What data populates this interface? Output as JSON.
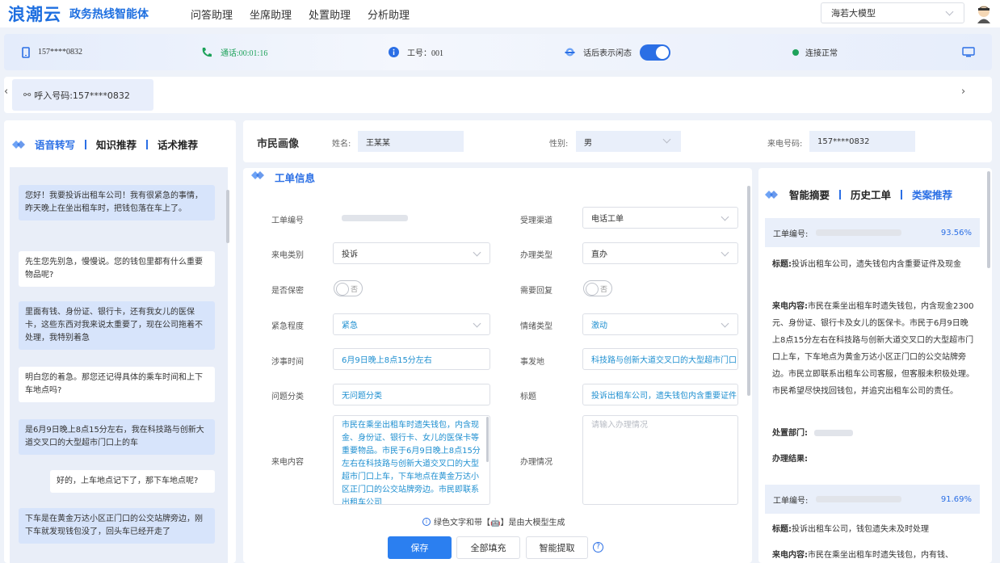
{
  "app": {
    "logo": "浪潮云",
    "subtitle": "政务热线智能体"
  },
  "nav": {
    "items": [
      "问答助理",
      "坐席助理",
      "处置助理",
      "分析助理"
    ]
  },
  "model_select": {
    "value": "海若大模型"
  },
  "status": {
    "phone": "157****0832",
    "call_time": "通话:00:01:16",
    "employee_id": "工号：001",
    "after_call_label": "话后表示闲态",
    "connection": "连接正常"
  },
  "callbar": {
    "caller_label": "呼入号码:157****0832"
  },
  "left_panel": {
    "tabs": [
      "语音转写",
      "知识推荐",
      "话术推荐"
    ],
    "messages": [
      {
        "role": "citizen",
        "text": "您好！我要投诉出租车公司！我有很紧急的事情，昨天晚上在坐出租车时，把钱包落在车上了。"
      },
      {
        "role": "agent",
        "text": "先生您先别急，慢慢说。您的钱包里都有什么重要物品呢?"
      },
      {
        "role": "citizen",
        "text": "里面有钱、身份证、银行卡，还有我女儿的医保卡，这些东西对我来说太重要了，现在公司拖着不处理，我特别着急"
      },
      {
        "role": "agent",
        "text": "明白您的着急。那您还记得具体的乘车时间和上下车地点吗?"
      },
      {
        "role": "citizen",
        "text": "是6月9日晚上8点15分左右，我在科技路与创新大道交叉口的大型超市门口上的车"
      },
      {
        "role": "agent",
        "text": "好的，上车地点记下了，那下车地点呢?"
      },
      {
        "role": "citizen",
        "text": "下车是在黄金万达小区正门口的公交站牌旁边，刚下车就发现钱包没了，回头车已经开走了"
      }
    ]
  },
  "profile": {
    "title": "市民画像",
    "name_label": "姓名:",
    "name_value": "王某某",
    "gender_label": "性别:",
    "gender_value": "男",
    "phone_label": "来电号码:",
    "phone_value": "157****0832"
  },
  "workorder": {
    "title": "工单信息",
    "fields": {
      "order_no": {
        "label": "工单编号",
        "value": ""
      },
      "channel": {
        "label": "受理渠道",
        "value": "电话工单"
      },
      "call_type": {
        "label": "来电类别",
        "value": "投诉"
      },
      "handle_type": {
        "label": "办理类型",
        "value": "直办"
      },
      "confidential": {
        "label": "是否保密",
        "value": "否"
      },
      "reply_needed": {
        "label": "需要回复",
        "value": "否"
      },
      "urgency": {
        "label": "紧急程度",
        "value": "紧急"
      },
      "emotion": {
        "label": "情绪类型",
        "value": "激动"
      },
      "time": {
        "label": "涉事时间",
        "value": "6月9日晚上8点15分左右"
      },
      "place": {
        "label": "事发地",
        "value": "科技路与创新大道交叉口的大型超市门口"
      },
      "category": {
        "label": "问题分类",
        "value": "无问题分类"
      },
      "subject": {
        "label": "标题",
        "value": "投诉出租车公司，遗失钱包内含重要证件"
      },
      "content": {
        "label": "来电内容",
        "value": "市民在乘坐出租车时遗失钱包，内含现金、身份证、银行卡、女儿的医保卡等重要物品。市民于6月9日晚上8点15分左右在科技路与创新大道交叉口的大型超市门口上车，下车地点在黄金万达小区正门口的公交站牌旁边。市民即联系出租车公司"
      },
      "handling": {
        "label": "办理情况",
        "placeholder": "请输入办理情况"
      }
    },
    "hint": "绿色文字和带【🤖】是由大模型生成",
    "buttons": {
      "save": "保存",
      "fill_all": "全部填充",
      "smart_extract": "智能提取"
    }
  },
  "summary_panel": {
    "tabs": [
      "智能摘要",
      "历史工单",
      "类案推荐"
    ],
    "cases": [
      {
        "order_label": "工单编号:",
        "score": "93.56%",
        "title_label": "标题:",
        "title": "投诉出租车公司，遗失钱包内含重要证件及现金",
        "content_label": "来电内容:",
        "content": "市民在乘坐出租车时遗失钱包，内含现金2300元、身份证、银行卡及女儿的医保卡。市民于6月9日晚上8点15分左右在科技路与创新大道交叉口的大型超市门口上车，下车地点为黄金万达小区正门口的公交站牌旁边。市民立即联系出租车公司客服，但客服未积极处理。市民希望尽快找回钱包，并追究出租车公司的责任。",
        "dept_label": "处置部门:",
        "result_label": "办理结果:"
      },
      {
        "order_label": "工单编号:",
        "score": "91.69%",
        "title_label": "标题:",
        "title": "投诉出租车公司，钱包遗失未及时处理",
        "content_label": "来电内容:",
        "content": "市民在乘坐出租车时遗失钱包，内有钱、"
      }
    ]
  },
  "colors": {
    "accent": "#2b6fe5",
    "generated_text": "#1e8fd0",
    "citizen_bubble": "#d7e4fb"
  }
}
